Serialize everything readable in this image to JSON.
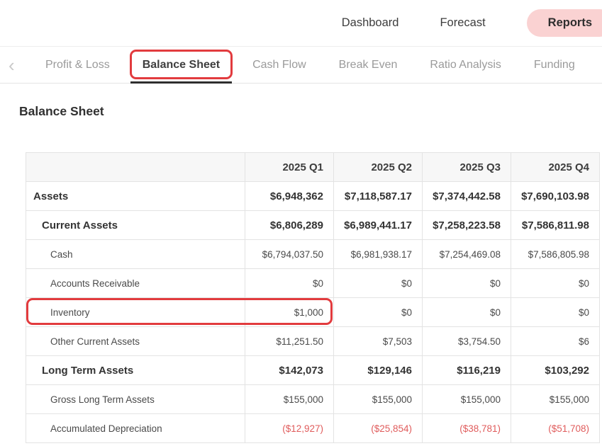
{
  "topnav": {
    "items": [
      {
        "label": "Dashboard"
      },
      {
        "label": "Forecast"
      },
      {
        "label": "Reports"
      }
    ]
  },
  "tabbar": {
    "back": "‹",
    "tabs": [
      {
        "label": "Profit & Loss"
      },
      {
        "label": "Balance Sheet"
      },
      {
        "label": "Cash Flow"
      },
      {
        "label": "Break Even"
      },
      {
        "label": "Ratio Analysis"
      },
      {
        "label": "Funding"
      }
    ]
  },
  "page_title": "Balance Sheet",
  "table": {
    "columns": [
      "2025 Q1",
      "2025 Q2",
      "2025 Q3",
      "2025 Q4"
    ],
    "rows": [
      {
        "label": "Assets",
        "values": [
          "$6,948,362",
          "$7,118,587.17",
          "$7,374,442.58",
          "$7,690,103.98"
        ]
      },
      {
        "label": "Current Assets",
        "values": [
          "$6,806,289",
          "$6,989,441.17",
          "$7,258,223.58",
          "$7,586,811.98"
        ]
      },
      {
        "label": "Cash",
        "values": [
          "$6,794,037.50",
          "$6,981,938.17",
          "$7,254,469.08",
          "$7,586,805.98"
        ]
      },
      {
        "label": "Accounts Receivable",
        "values": [
          "$0",
          "$0",
          "$0",
          "$0"
        ]
      },
      {
        "label": "Inventory",
        "values": [
          "$1,000",
          "$0",
          "$0",
          "$0"
        ]
      },
      {
        "label": "Other Current Assets",
        "values": [
          "$11,251.50",
          "$7,503",
          "$3,754.50",
          "$6"
        ]
      },
      {
        "label": "Long Term Assets",
        "values": [
          "$142,073",
          "$129,146",
          "$116,219",
          "$103,292"
        ]
      },
      {
        "label": "Gross Long Term Assets",
        "values": [
          "$155,000",
          "$155,000",
          "$155,000",
          "$155,000"
        ]
      },
      {
        "label": "Accumulated Depreciation",
        "values": [
          "($12,927)",
          "($25,854)",
          "($38,781)",
          "($51,708)"
        ]
      }
    ]
  },
  "colors": {
    "reports_pill_bg": "#fad2d2",
    "annotation_red": "#e23b3e",
    "negative_value_red": "#e05c5c",
    "active_tab_underline": "#2f2f2f",
    "table_border": "#e3e3e3",
    "header_bg": "#f7f7f7"
  }
}
